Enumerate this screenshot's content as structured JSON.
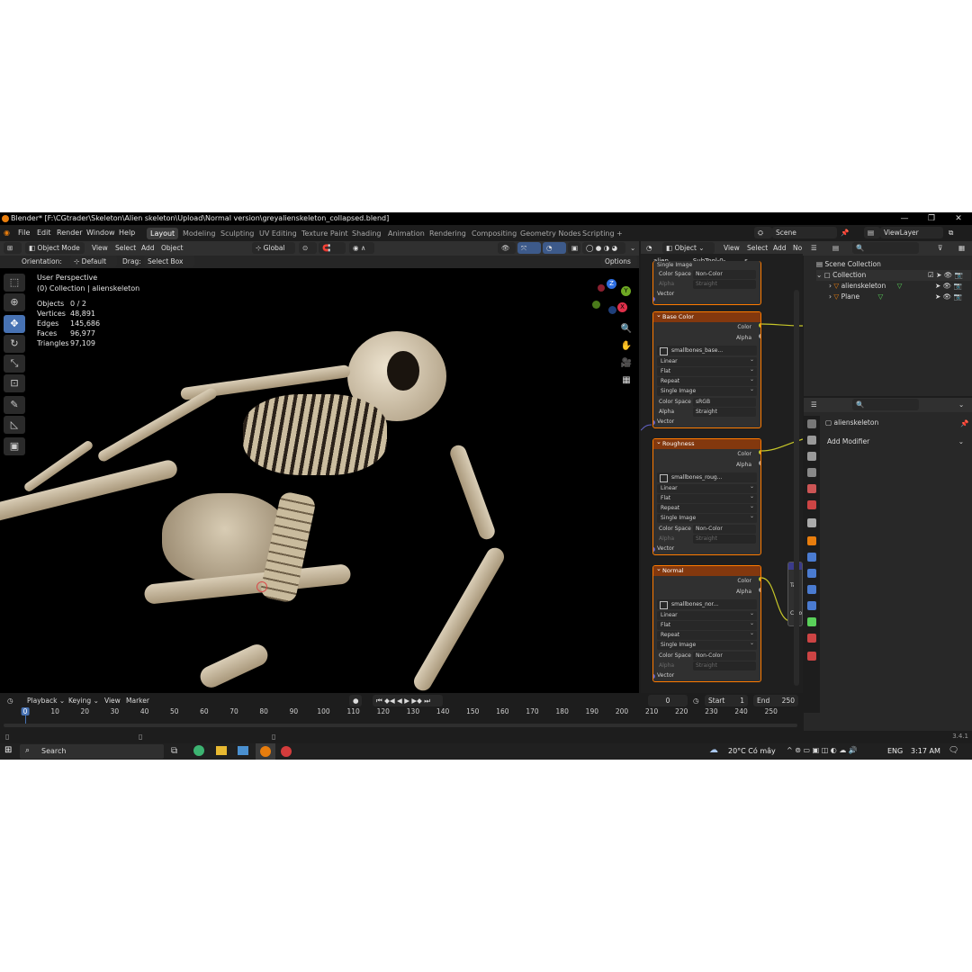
{
  "window": {
    "title": "Blender* [F:\\CGtrader\\Skeleton\\Alien skeleton\\Upload\\Normal version\\greyalienskeleton_collapsed.blend]",
    "controls": [
      "—",
      "❐",
      "✕"
    ]
  },
  "menu": [
    "File",
    "Edit",
    "Render",
    "Window",
    "Help"
  ],
  "workspaces": [
    "Layout",
    "Modeling",
    "Sculpting",
    "UV Editing",
    "Texture Paint",
    "Shading",
    "Animation",
    "Rendering",
    "Compositing",
    "Geometry Nodes",
    "Scripting",
    "+"
  ],
  "active_workspace": "Layout",
  "scene": "Scene",
  "view_layer": "ViewLayer",
  "viewport_header": {
    "mode": "Object Mode",
    "items": [
      "View",
      "Select",
      "Add",
      "Object"
    ],
    "transform": "Global",
    "orientation_label": "Orientation:",
    "orientation": "Default",
    "drag_label": "Drag:",
    "drag": "Select Box",
    "options": "Options"
  },
  "viewport": {
    "perspective": "User Perspective",
    "collection": "(0) Collection | alienskeleton",
    "stats": [
      {
        "label": "Objects",
        "value": "0 / 2"
      },
      {
        "label": "Vertices",
        "value": "48,891"
      },
      {
        "label": "Edges",
        "value": "145,686"
      },
      {
        "label": "Faces",
        "value": "96,977"
      },
      {
        "label": "Triangles",
        "value": "97,109"
      }
    ],
    "gizmo": {
      "x": "X",
      "y": "Y",
      "z": "Z"
    }
  },
  "node_header": {
    "object": "Object",
    "items": [
      "View",
      "Select",
      "Add",
      "No"
    ],
    "breadcrumb_a": "alien...",
    "breadcrumb_b": "SubTool-0-...",
    "breadcrumb_c": "s..."
  },
  "nodes": {
    "top": {
      "title": "Single Image",
      "color_space_label": "Color Space",
      "color_space": "Non-Color",
      "alpha_label": "Alpha",
      "alpha": "Straight",
      "vector": "Vector"
    },
    "base_color": {
      "title": "Base Color",
      "out_color": "Color",
      "out_alpha": "Alpha",
      "image": "smallbones_base...",
      "interp": "Linear",
      "projection": "Flat",
      "extension": "Repeat",
      "source": "Single Image",
      "color_space_label": "Color Space",
      "color_space": "sRGB",
      "alpha_label": "Alpha",
      "alpha": "Straight",
      "vector": "Vector"
    },
    "roughness": {
      "title": "Roughness",
      "out_color": "Color",
      "out_alpha": "Alpha",
      "image": "smallbones_roug...",
      "interp": "Linear",
      "projection": "Flat",
      "extension": "Repeat",
      "source": "Single Image",
      "color_space_label": "Color Space",
      "color_space": "Non-Color",
      "alpha_label": "Alpha",
      "alpha": "Straight",
      "vector": "Vector"
    },
    "normal": {
      "title": "Normal",
      "out_color": "Color",
      "out_alpha": "Alpha",
      "image": "smallbones_nor...",
      "interp": "Linear",
      "projection": "Flat",
      "extension": "Repeat",
      "source": "Single Image",
      "color_space_label": "Color Space",
      "color_space": "Non-Color",
      "alpha_label": "Alpha",
      "alpha": "Straight",
      "vector": "Vector"
    },
    "side_partial": {
      "a": "Ta",
      "b": "Colo"
    }
  },
  "outliner": {
    "root": "Scene Collection",
    "collection": "Collection",
    "objects": [
      "alienskeleton",
      "Plane"
    ]
  },
  "properties": {
    "object": "alienskeleton",
    "add_modifier": "Add Modifier"
  },
  "timeline": {
    "items": [
      "Playback",
      "Keying",
      "View",
      "Marker"
    ],
    "current_frame": "0",
    "start_label": "Start",
    "start": "1",
    "end_label": "End",
    "end": "250",
    "ticks": [
      "0",
      "10",
      "20",
      "30",
      "40",
      "50",
      "60",
      "70",
      "80",
      "90",
      "100",
      "110",
      "120",
      "130",
      "140",
      "150",
      "160",
      "170",
      "180",
      "190",
      "200",
      "210",
      "220",
      "230",
      "240",
      "250"
    ]
  },
  "status": {
    "version": "3.4.1"
  },
  "taskbar": {
    "search": "Search",
    "weather": "20°C  Có mây",
    "lang": "ENG",
    "time": "3:17 AM"
  },
  "colors": {
    "accent": "#4772b3",
    "node_border": "#ff7b00",
    "node_header": "#83380e",
    "socket_yellow": "#c7c729",
    "socket_purple": "#6363c7",
    "socket_grey": "#a1a1a1"
  }
}
